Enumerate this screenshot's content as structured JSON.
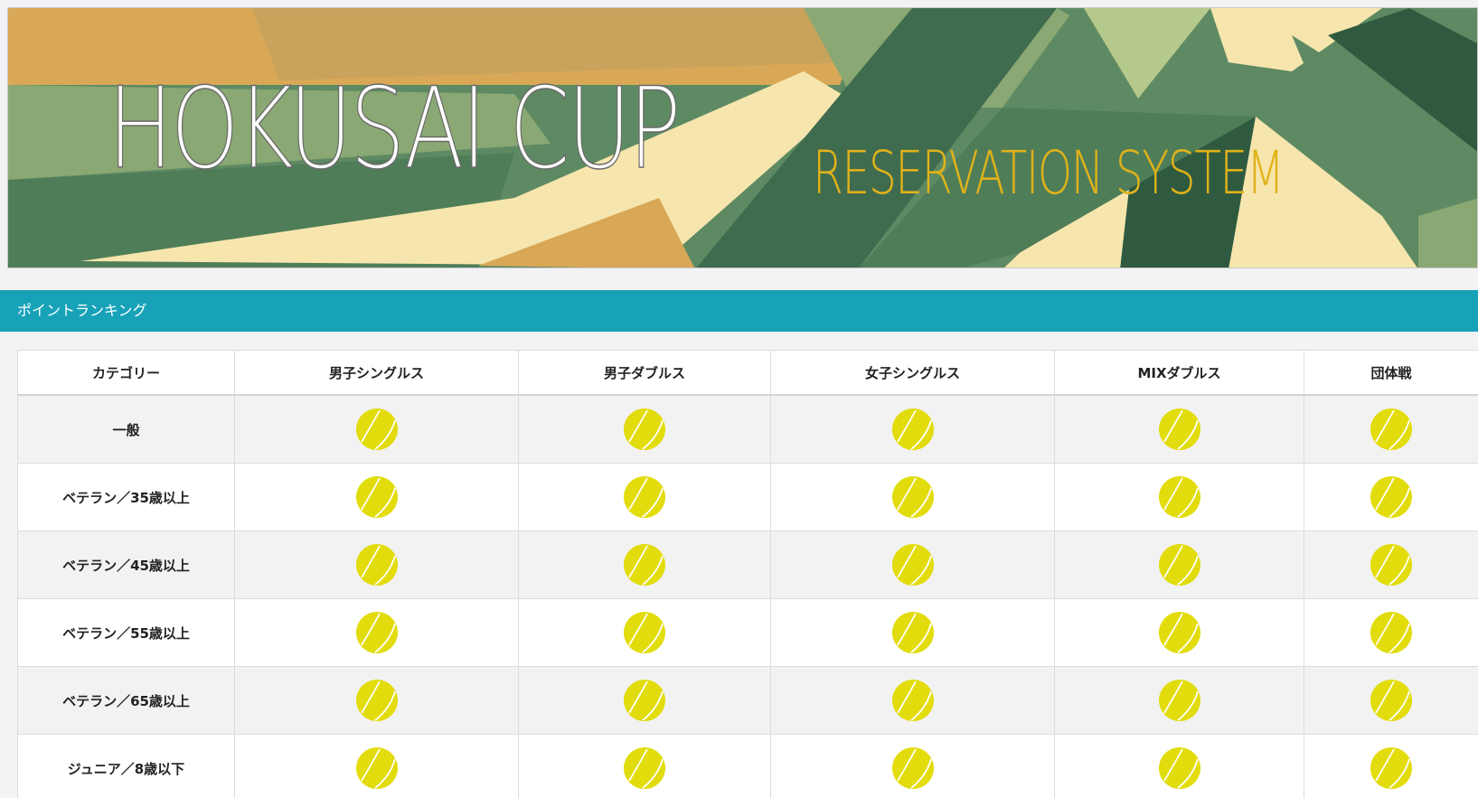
{
  "banner": {
    "title": "HOKUSAI CUP",
    "subtitle": "RESERVATION SYSTEM",
    "colors": {
      "green_dark": "#3f6b4e",
      "green_mid": "#5e8a63",
      "green_light": "#8aa873",
      "cream": "#f6e6ad",
      "gold": "#d9a857",
      "title_fill": "#ffffff",
      "subtitle": "#e0b21a"
    }
  },
  "section": {
    "title": "ポイントランキング",
    "color": "#17a2b8"
  },
  "table": {
    "headers": [
      "カテゴリー",
      "男子シングルス",
      "男子ダブルス",
      "女子シングルス",
      "MIXダブルス",
      "団体戦"
    ],
    "rows": [
      {
        "category": "一般",
        "icons": [
          "tennis-ball-icon",
          "tennis-ball-icon",
          "tennis-ball-icon",
          "tennis-ball-icon",
          "tennis-ball-icon"
        ]
      },
      {
        "category": "ベテラン／35歳以上",
        "icons": [
          "tennis-ball-icon",
          "tennis-ball-icon",
          "tennis-ball-icon",
          "tennis-ball-icon",
          "tennis-ball-icon"
        ]
      },
      {
        "category": "ベテラン／45歳以上",
        "icons": [
          "tennis-ball-icon",
          "tennis-ball-icon",
          "tennis-ball-icon",
          "tennis-ball-icon",
          "tennis-ball-icon"
        ]
      },
      {
        "category": "ベテラン／55歳以上",
        "icons": [
          "tennis-ball-icon",
          "tennis-ball-icon",
          "tennis-ball-icon",
          "tennis-ball-icon",
          "tennis-ball-icon"
        ]
      },
      {
        "category": "ベテラン／65歳以上",
        "icons": [
          "tennis-ball-icon",
          "tennis-ball-icon",
          "tennis-ball-icon",
          "tennis-ball-icon",
          "tennis-ball-icon"
        ]
      },
      {
        "category": "ジュニア／8歳以下",
        "icons": [
          "tennis-ball-icon",
          "tennis-ball-icon",
          "tennis-ball-icon",
          "tennis-ball-icon",
          "tennis-ball-icon"
        ]
      }
    ],
    "ball_color": "#e2dc0c"
  }
}
